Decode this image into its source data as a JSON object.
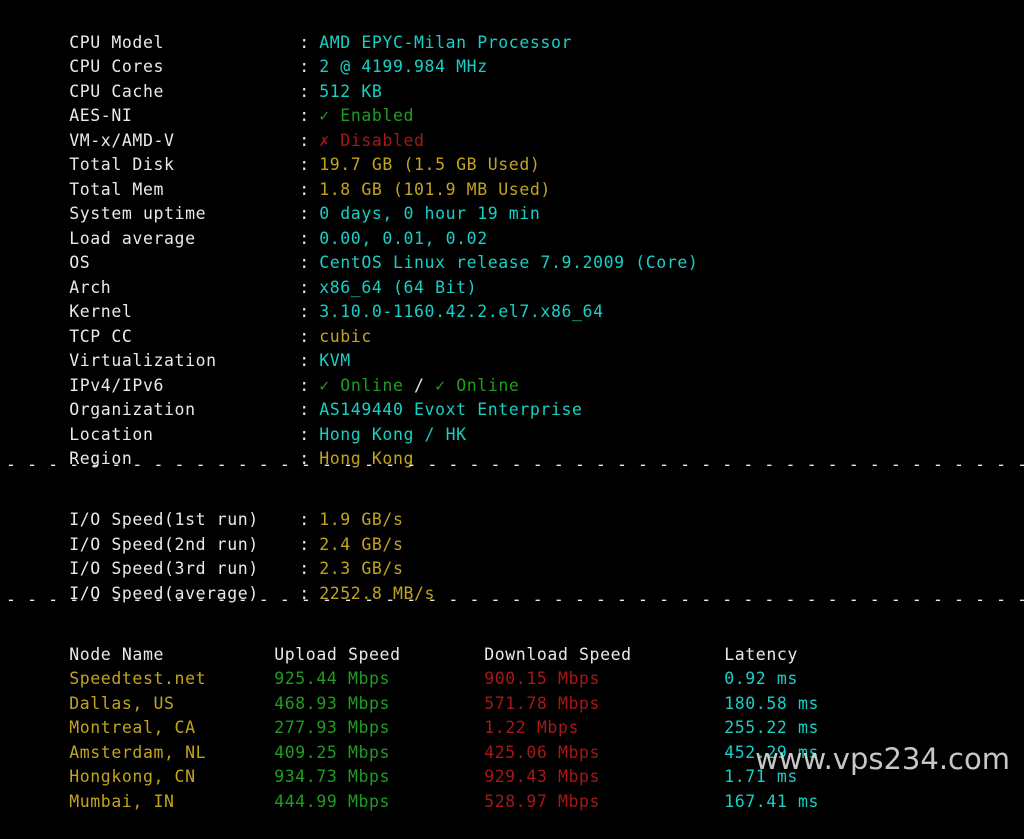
{
  "terminal": {
    "background": "#000000",
    "colors": {
      "white": "#e9e9e9",
      "cyan": "#18cfc6",
      "gold": "#c2a41c",
      "green": "#1f9c21",
      "red": "#a41818"
    },
    "separator": "- - - - - - - - - - - - - - - - - - - - - - - - - - - - - - - - - - - - - - - - - - - - - - - - - - - -"
  },
  "system_info": [
    {
      "label": "CPU Model",
      "value": "AMD EPYC-Milan Processor"
    },
    {
      "label": "CPU Cores",
      "value": "2 @ 4199.984 MHz"
    },
    {
      "label": "CPU Cache",
      "value": "512 KB"
    },
    {
      "label": "AES-NI",
      "value": "Enabled",
      "mark": "✓",
      "status": "ok"
    },
    {
      "label": "VM-x/AMD-V",
      "value": "Disabled",
      "mark": "✗",
      "status": "bad"
    },
    {
      "label": "Total Disk",
      "value": "19.7 GB (1.5 GB Used)"
    },
    {
      "label": "Total Mem",
      "value": "1.8 GB (101.9 MB Used)"
    },
    {
      "label": "System uptime",
      "value": "0 days, 0 hour 19 min"
    },
    {
      "label": "Load average",
      "value": "0.00, 0.01, 0.02"
    },
    {
      "label": "OS",
      "value": "CentOS Linux release 7.9.2009 (Core)"
    },
    {
      "label": "Arch",
      "value": "x86_64 (64 Bit)"
    },
    {
      "label": "Kernel",
      "value": "3.10.0-1160.42.2.el7.x86_64"
    },
    {
      "label": "TCP CC",
      "value": "cubic"
    },
    {
      "label": "Virtualization",
      "value": "KVM"
    },
    {
      "label": "IPv4/IPv6",
      "value_ipv4": "Online",
      "value_ipv6": "Online",
      "mark": "✓",
      "slash": "/"
    },
    {
      "label": "Organization",
      "value": "AS149440 Evoxt Enterprise"
    },
    {
      "label": "Location",
      "value": "Hong Kong / HK"
    },
    {
      "label": "Region",
      "value": "Hong Kong"
    }
  ],
  "io_speed": [
    {
      "label": "I/O Speed(1st run)",
      "value": "1.9 GB/s"
    },
    {
      "label": "I/O Speed(2nd run)",
      "value": "2.4 GB/s"
    },
    {
      "label": "I/O Speed(3rd run)",
      "value": "2.3 GB/s"
    },
    {
      "label": "I/O Speed(average)",
      "value": "2252.8 MB/s"
    }
  ],
  "speedtest": {
    "headers": {
      "node": "Node Name",
      "upload": "Upload Speed",
      "download": "Download Speed",
      "latency": "Latency"
    },
    "rows": [
      {
        "node": "Speedtest.net",
        "upload": "925.44 Mbps",
        "download": "900.15 Mbps",
        "latency": "0.92 ms"
      },
      {
        "node": "Dallas, US",
        "upload": "468.93 Mbps",
        "download": "571.78 Mbps",
        "latency": "180.58 ms"
      },
      {
        "node": "Montreal, CA",
        "upload": "277.93 Mbps",
        "download": "1.22 Mbps",
        "latency": "255.22 ms"
      },
      {
        "node": "Amsterdam, NL",
        "upload": "409.25 Mbps",
        "download": "425.06 Mbps",
        "latency": "452.29 ms"
      },
      {
        "node": "Hongkong, CN",
        "upload": "934.73 Mbps",
        "download": "929.43 Mbps",
        "latency": "1.71 ms"
      },
      {
        "node": "Mumbai, IN",
        "upload": "444.99 Mbps",
        "download": "528.97 Mbps",
        "latency": "167.41 ms"
      }
    ]
  },
  "watermark": {
    "text": "www.vps234.com"
  }
}
